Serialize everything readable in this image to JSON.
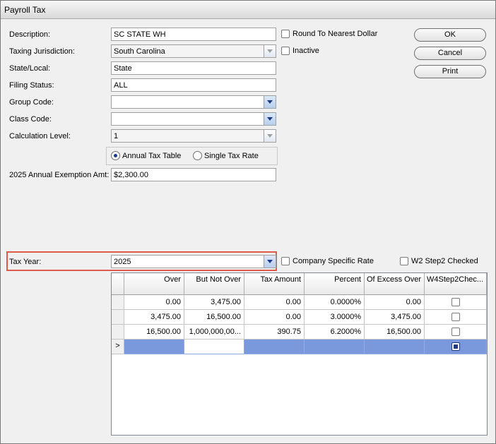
{
  "window": {
    "title": "Payroll Tax"
  },
  "form": {
    "description": {
      "label": "Description:",
      "value": "SC STATE WH"
    },
    "taxing_jurisdiction": {
      "label": "Taxing Jurisdiction:",
      "value": "South Carolina"
    },
    "state_local": {
      "label": "State/Local:",
      "value": "State"
    },
    "filing_status": {
      "label": "Filing Status:",
      "value": "ALL"
    },
    "group_code": {
      "label": "Group Code:",
      "value": ""
    },
    "class_code": {
      "label": "Class Code:",
      "value": ""
    },
    "calculation_level": {
      "label": "Calculation Level:",
      "value": "1"
    },
    "exemption": {
      "label": "2025 Annual Exemption Amt:",
      "value": "$2,300.00"
    },
    "tax_year": {
      "label": "Tax Year:",
      "value": "2025"
    }
  },
  "options": {
    "round_label": "Round To Nearest Dollar",
    "inactive_label": "Inactive",
    "company_rate_label": "Company Specific Rate",
    "w2_step2_label": "W2 Step2 Checked"
  },
  "radios": {
    "annual_label": "Annual Tax Table",
    "single_label": "Single Tax Rate",
    "selected": "annual"
  },
  "buttons": {
    "ok": "OK",
    "cancel": "Cancel",
    "print": "Print"
  },
  "grid": {
    "columns": [
      "Over",
      "But Not Over",
      "Tax Amount",
      "Percent",
      "Of Excess Over",
      "W4Step2Chec..."
    ],
    "rows": [
      [
        "0.00",
        "3,475.00",
        "0.00",
        "0.0000%",
        "0.00"
      ],
      [
        "3,475.00",
        "16,500.00",
        "0.00",
        "3.0000%",
        "3,475.00"
      ],
      [
        "16,500.00",
        "1,000,000,00...",
        "390.75",
        "6.2000%",
        "16,500.00"
      ]
    ],
    "new_row_marker": ">"
  },
  "colors": {
    "highlight": "#e05a4a",
    "selection": "#7a99dd",
    "accent": "#1a3a8a"
  }
}
